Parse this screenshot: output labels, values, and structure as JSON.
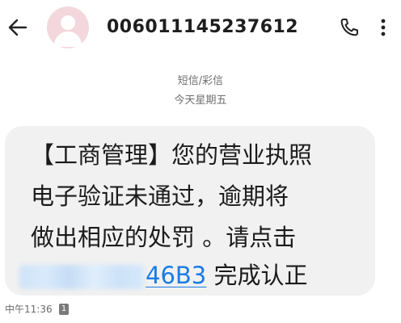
{
  "header": {
    "contact_number": "006011145237612"
  },
  "conversation": {
    "message_type": "短信/彩信",
    "date": "今天星期五"
  },
  "message": {
    "line1": "【工商管理】您的营业执照",
    "line2": "电子验证未通过，逾期将",
    "line3": "做出相应的处罚 。请点击",
    "link_visible": "46B3",
    "line4_suffix": " 完成认正",
    "time": "中午11:36",
    "sim_badge": "1"
  },
  "colors": {
    "bubble": "#f1f1f1",
    "link": "#1a7be6",
    "avatar": "#f3d7dc"
  }
}
